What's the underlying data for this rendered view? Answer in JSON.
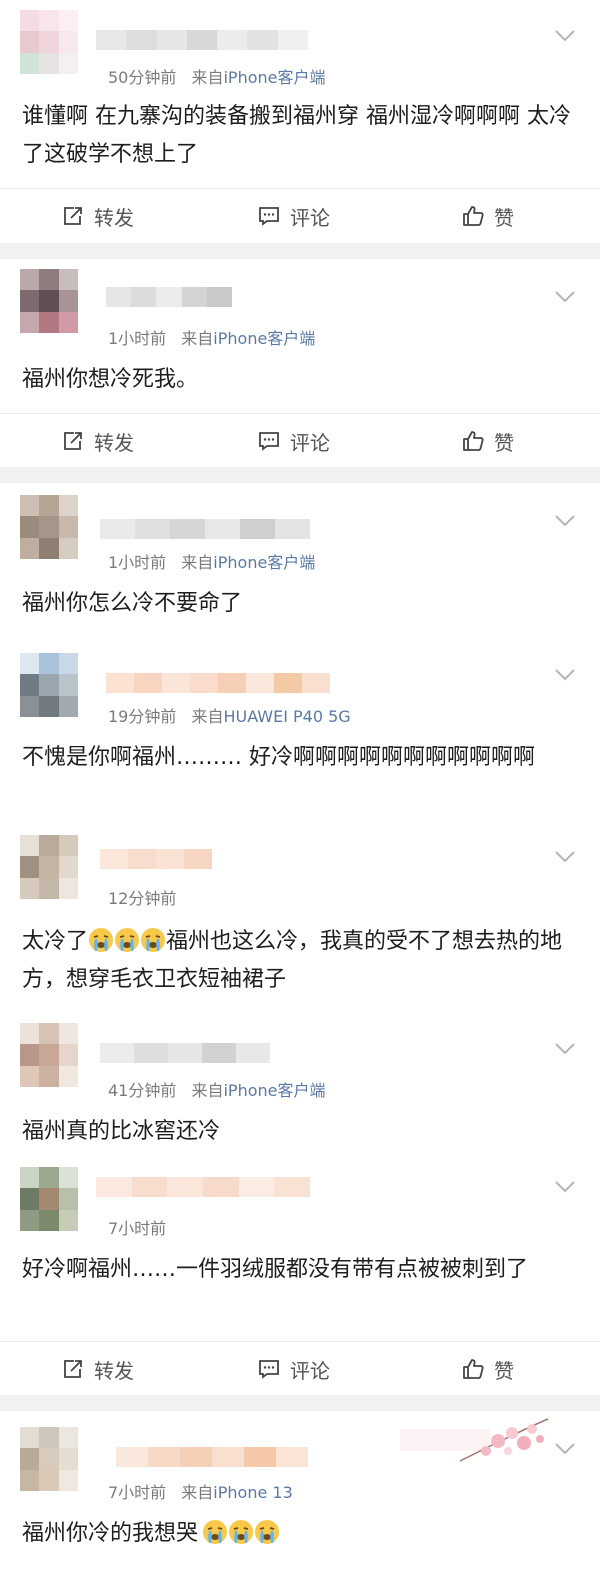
{
  "actions": {
    "repost": "转发",
    "comment": "评论",
    "like": "赞"
  },
  "posts": [
    {
      "meta_time": "50分钟前",
      "meta_from": "来自",
      "meta_device": "iPhone客户端",
      "text": "谁懂啊 在九寨沟的装备搬到福州穿 福州湿冷啊啊啊 太冷了这破学不想上了"
    },
    {
      "meta_time": "1小时前",
      "meta_from": "来自",
      "meta_device": "iPhone客户端",
      "text": "福州你想冷死我。"
    },
    {
      "meta_time": "1小时前",
      "meta_from": "来自",
      "meta_device": "iPhone客户端",
      "text": "福州你怎么冷不要命了"
    },
    {
      "meta_time": "19分钟前",
      "meta_from": "来自",
      "meta_device": "HUAWEI P40 5G",
      "text": "不愧是你啊福州……… 好冷啊啊啊啊啊啊啊啊啊啊啊"
    },
    {
      "meta_time": "12分钟前",
      "text_before": "太冷了",
      "text_after": "福州也这么冷，我真的受不了想去热的地方，想穿毛衣卫衣短袖裙子"
    },
    {
      "meta_time": "41分钟前",
      "meta_from": "来自",
      "meta_device": "iPhone客户端",
      "text": "福州真的比冰窖还冷"
    },
    {
      "meta_time": "7小时前",
      "text": "好冷啊福州……一件羽绒服都没有带有点被被刺到了"
    },
    {
      "meta_time": "7小时前",
      "meta_from": "来自",
      "meta_device": "iPhone 13",
      "text": "福州你冷的我想哭"
    }
  ],
  "icons": {
    "chevron": "chevron-down-icon",
    "repost": "repost-icon",
    "comment": "comment-icon",
    "like": "thumbs-up-icon",
    "crying": "crying-emoji-icon"
  },
  "colors": {
    "meta": "#7b7b7b",
    "source_link": "#5b7aa6",
    "separator": "#f2f2f2"
  }
}
